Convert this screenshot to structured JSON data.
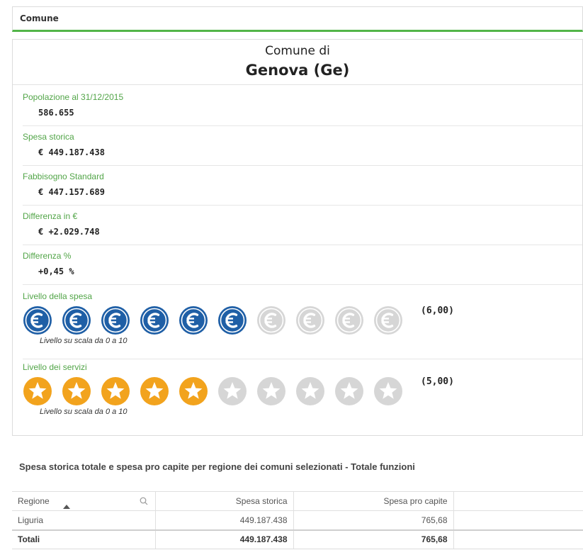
{
  "filter": {
    "label": "Comune"
  },
  "header": {
    "line1": "Comune di",
    "line2": "Genova (Ge)"
  },
  "kpis": [
    {
      "label": "Popolazione al 31/12/2015",
      "value": "586.655"
    },
    {
      "label": "Spesa storica",
      "value": "€ 449.187.438"
    },
    {
      "label": "Fabbisogno Standard",
      "value": "€ 447.157.689"
    },
    {
      "label": "Differenza in €",
      "value": "€ +2.029.748"
    },
    {
      "label": "Differenza %",
      "value": "+0,45 %"
    }
  ],
  "spesa_level": {
    "label": "Livello della spesa",
    "score": "(6,00)",
    "value": 6,
    "max": 10,
    "note": "Livello su scala da 0 a 10",
    "icon": "euro-coin-icon",
    "active_color": "#1f5fa6",
    "inactive_color": "#d6d6d6"
  },
  "servizi_level": {
    "label": "Livello dei servizi",
    "score": "(5,00)",
    "value": 5,
    "max": 10,
    "note": "Livello su scala da 0 a 10",
    "icon": "star-icon",
    "active_color": "#f2a31d",
    "inactive_color": "#d6d6d6"
  },
  "table": {
    "title": "Spesa storica totale e spesa pro capite per regione dei comuni selezionati - Totale funzioni",
    "columns": [
      "Regione",
      "Spesa storica",
      "Spesa pro capite"
    ],
    "rows": [
      {
        "regione": "Liguria",
        "spesa_storica": "449.187.438",
        "pro_capite": "765,68"
      }
    ],
    "totals": {
      "label": "Totali",
      "spesa_storica": "449.187.438",
      "pro_capite": "765,68"
    }
  },
  "colors": {
    "accent_green": "#52b548"
  }
}
